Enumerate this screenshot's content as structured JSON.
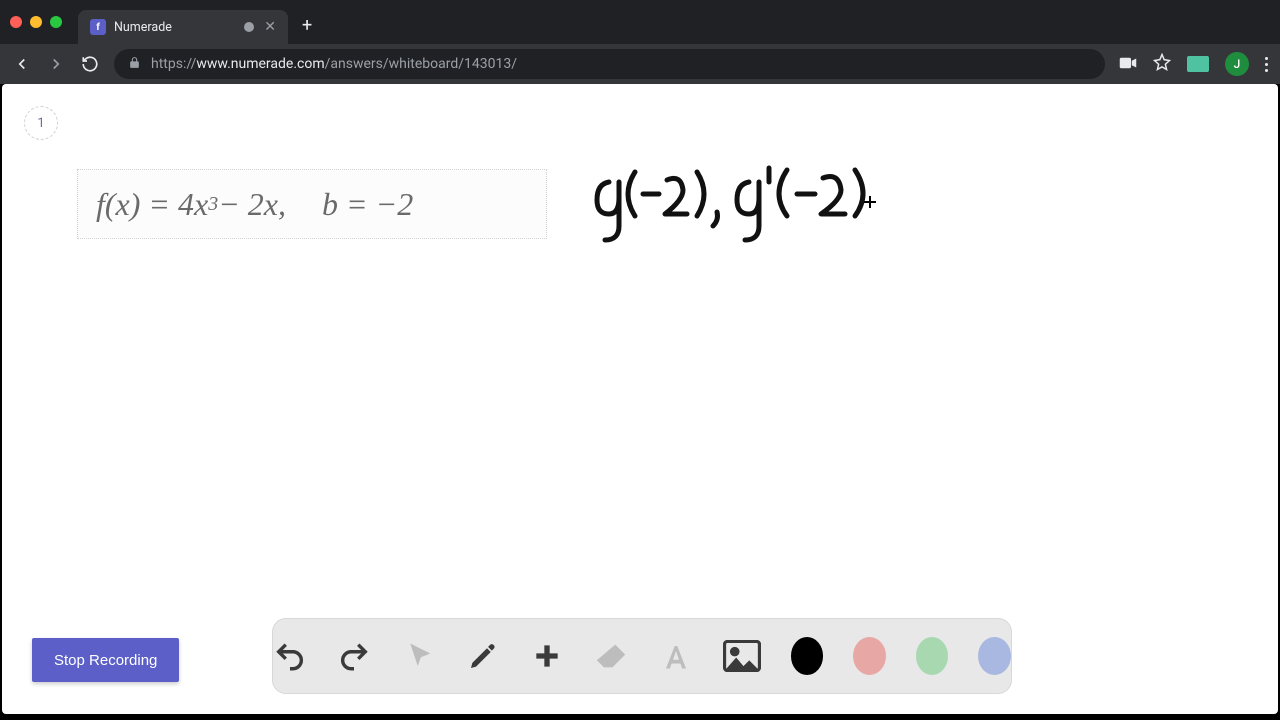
{
  "browser": {
    "tab_title": "Numerade",
    "favicon_letter": "f",
    "url_protocol": "https://",
    "url_host": "www.numerade.com",
    "url_path": "/answers/whiteboard/143013/",
    "profile_initial": "J"
  },
  "whiteboard": {
    "page_number": "1",
    "formula_fx": "f(x) = 4x",
    "formula_sup": "3",
    "formula_tail": " − 2x,",
    "formula_b": "b = −2",
    "handwritten_label": "g(-2) , g'(-2)"
  },
  "controls": {
    "stop_label": "Stop Recording"
  },
  "colors": {
    "accent": "#5b5fc7",
    "swatch_black": "#000000",
    "swatch_red": "#e7a8a5",
    "swatch_green": "#a8d8b0",
    "swatch_blue": "#a8b8e0"
  }
}
